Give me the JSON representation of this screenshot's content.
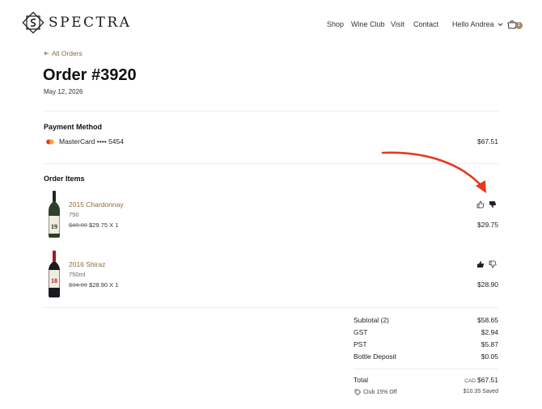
{
  "brand": {
    "name": "SPECTRA"
  },
  "nav": {
    "items": [
      "Shop",
      "Wine Club",
      "Visit",
      "Contact"
    ],
    "user_greeting": "Hello Andrea",
    "cart_count": "1"
  },
  "order": {
    "back_label": "All Orders",
    "title": "Order #3920",
    "date": "May 12, 2026"
  },
  "payment": {
    "heading": "Payment Method",
    "method": "MasterCard •••• 5454",
    "amount": "$67.51"
  },
  "items_heading": "Order Items",
  "items": [
    {
      "name": "2015 Chardonnay",
      "volume": "750",
      "original_price": "$40.00",
      "price": "$29.75",
      "qty": "X 1",
      "total": "$29.75",
      "bottle_label": "19",
      "rating": "dislike"
    },
    {
      "name": "2016 Shiraz",
      "volume": "750ml",
      "original_price": "$34.00",
      "price": "$28.90",
      "qty": "X 1",
      "total": "$28.90",
      "bottle_label": "18",
      "rating": "like"
    }
  ],
  "summary": {
    "subtotal_label": "Subtotal (2)",
    "subtotal": "$58.65",
    "gst_label": "GST",
    "gst": "$2.94",
    "pst_label": "PST",
    "pst": "$5.87",
    "deposit_label": "Bottle Deposit",
    "deposit": "$0.05",
    "total_label": "Total",
    "currency": "CAD",
    "total": "$67.51",
    "discount_label": "Club 15% Off",
    "saved": "$10.35 Saved"
  },
  "colors": {
    "accent": "#8a6d3b",
    "arrow": "#e53a1e",
    "badge": "#a08a6b"
  }
}
